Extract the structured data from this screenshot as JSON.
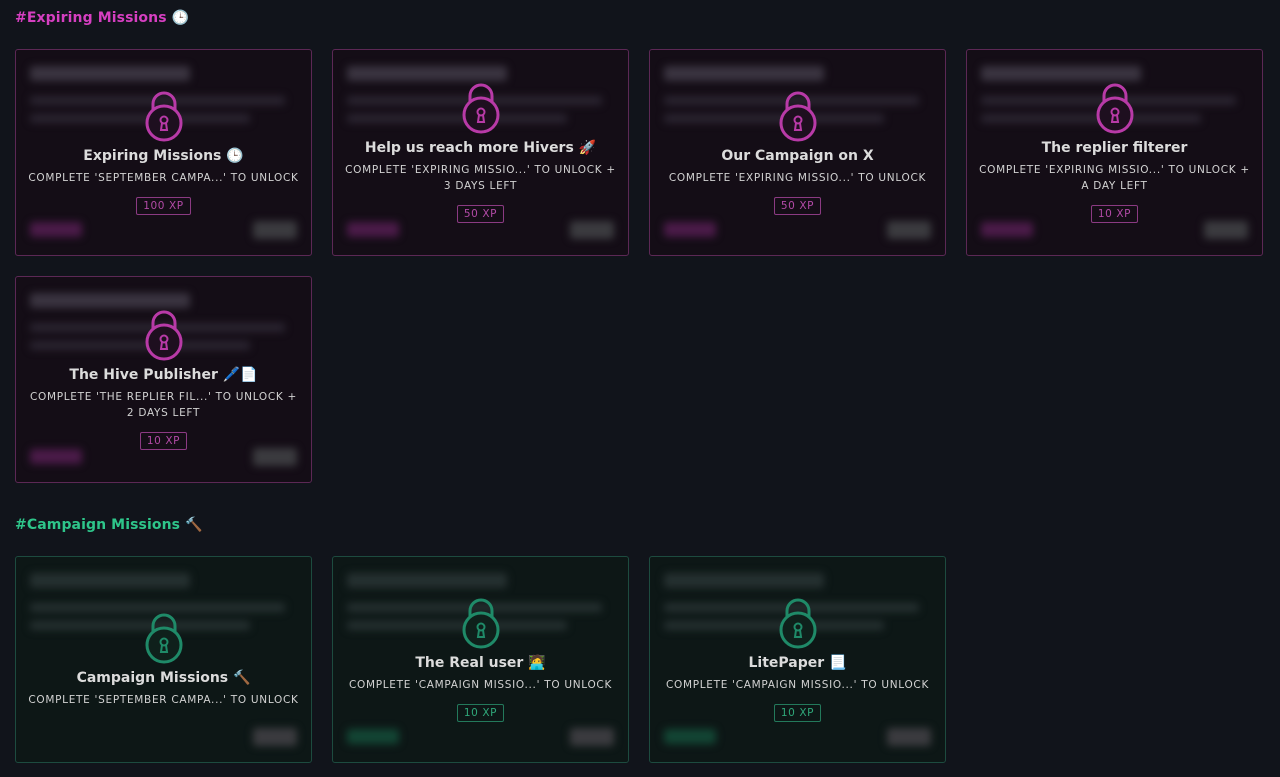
{
  "sections": [
    {
      "title": "#Expiring Missions 🕒",
      "color": "#d63fc1",
      "cards": [
        {
          "title": "Expiring Missions 🕒",
          "subtitle": "COMPLETE 'SEPTEMBER CAMPA...' TO UNLOCK",
          "xp": "100 XP"
        },
        {
          "title": "Help us reach more Hivers 🚀",
          "subtitle": "COMPLETE 'EXPIRING MISSIO...' TO UNLOCK + 3 DAYS LEFT",
          "xp": "50 XP"
        },
        {
          "title": "Our Campaign on X",
          "subtitle": "COMPLETE 'EXPIRING MISSIO...' TO UNLOCK",
          "xp": "50 XP"
        },
        {
          "title": "The replier filterer",
          "subtitle": "COMPLETE 'EXPIRING MISSIO...' TO UNLOCK + A DAY LEFT",
          "xp": "10 XP"
        },
        {
          "title": "The Hive Publisher 🖊️📄",
          "subtitle": "COMPLETE 'THE REPLIER FIL...' TO UNLOCK + 2 DAYS LEFT",
          "xp": "10 XP"
        }
      ]
    },
    {
      "title": "#Campaign Missions 🔨",
      "color": "#2ec58a",
      "cards": [
        {
          "title": "Campaign Missions 🔨",
          "subtitle": "COMPLETE 'SEPTEMBER CAMPA...' TO UNLOCK",
          "xp": ""
        },
        {
          "title": "The Real user 🧑‍💻",
          "subtitle": "COMPLETE 'CAMPAIGN MISSIO...' TO UNLOCK",
          "xp": "10 XP"
        },
        {
          "title": "LitePaper 📃",
          "subtitle": "COMPLETE 'CAMPAIGN MISSIO...' TO UNLOCK",
          "xp": "10 XP"
        }
      ]
    }
  ],
  "icons": {
    "locked": "lock-icon"
  },
  "colors": {
    "pink_lock": "#b83aa7",
    "green_lock": "#1f8a68",
    "background": "#11141b"
  }
}
